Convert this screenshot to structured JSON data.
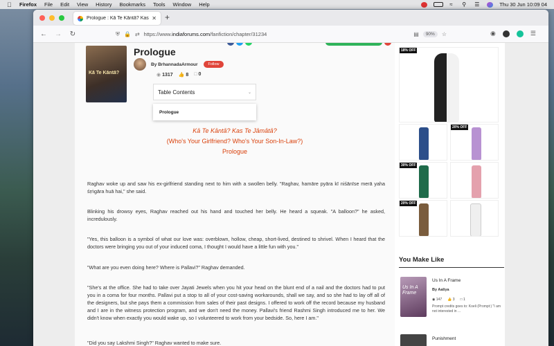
{
  "menubar": {
    "app": "Firefox",
    "items": [
      "File",
      "Edit",
      "View",
      "History",
      "Bookmarks",
      "Tools",
      "Window",
      "Help"
    ],
    "clock": "Thu 30 Jun  10:09 04"
  },
  "browser": {
    "tab_title": "Prologue : Kā Te Kāntā? Kas Te Jā",
    "url_prefix": "https://www.",
    "url_host": "indiaforums.com",
    "url_path": "/fanfiction/chapter/31234",
    "zoom": "90%"
  },
  "story": {
    "cover_text": "Kā Te Kāntā?",
    "title": "Prologue",
    "author": "By BrhannadaArmour",
    "follow": "Follow",
    "views": "1317",
    "likes": "8",
    "comments": "0",
    "toc_label": "Table Contents",
    "toc_item": "Prologue",
    "heading1": "Kā Te Kāntā? Kas Te Jāmātā?",
    "heading2": "(Who's Your Girlfriend? Who's Your Son-In-Law?)",
    "heading3": "Prologue"
  },
  "paragraphs": [
    "Raghav woke up and saw his ex-girlfriend standing next to him with a swollen belly. \"Raghav, hamāre pyāra kī niśānīse merā yaha śṛṅgāra huā hai,\" she said.",
    "Blinking his drowsy eyes, Raghav reached out his hand and touched her belly. He heard a squeak. \"A balloon?\" he asked, incredulously.",
    "\"Yes, this balloon is a symbol of what our love was: overblown, hollow, cheap, short-lived, destined to shrivel. When I heard that the doctors were bringing you out of your induced coma, I thought I would have a little fun with you.\"",
    "\"What are you even doing here? Where is Pallavi?\" Raghav demanded.",
    "\"She's at the office. She had to take over Jayati Jewels when you hit your head on the blunt end of a nail and the doctors had to put you in a coma for four months. Pallavi put a stop to all of your cost-saving workarounds, shall we say, and so she had to lay off all of the designers, but she pays them a commission from sales of their past designs. I offered to work off the record because my husband and I are in the witness protection program, and we don't need the money. Pallavi's friend Rashmi Singh introduced me to her. We didn't know when exactly you would wake up, so I volunteered to work from your bedside. So, here I am.\"",
    "\"Did you say Lakshmi Singh?\" Raghav wanted to make sure."
  ],
  "ads": {
    "tags": [
      "18% OFF",
      "20% OFF",
      "30% OFF",
      "20% OFF"
    ]
  },
  "sidebar": {
    "heading": "You Make Like",
    "card1": {
      "cover_text": "Us In A Frame",
      "title": "Us In A Frame",
      "author": "By Aaliya",
      "views": "147",
      "likes": "3",
      "comments": "1",
      "desc": "Prompt credits goes to: Koeli (Prompt:) \"I am not interested in ..."
    },
    "card2": {
      "title": "Punishment"
    }
  },
  "colors": {
    "accent": "#d9400b",
    "follow": "#e0453a"
  }
}
